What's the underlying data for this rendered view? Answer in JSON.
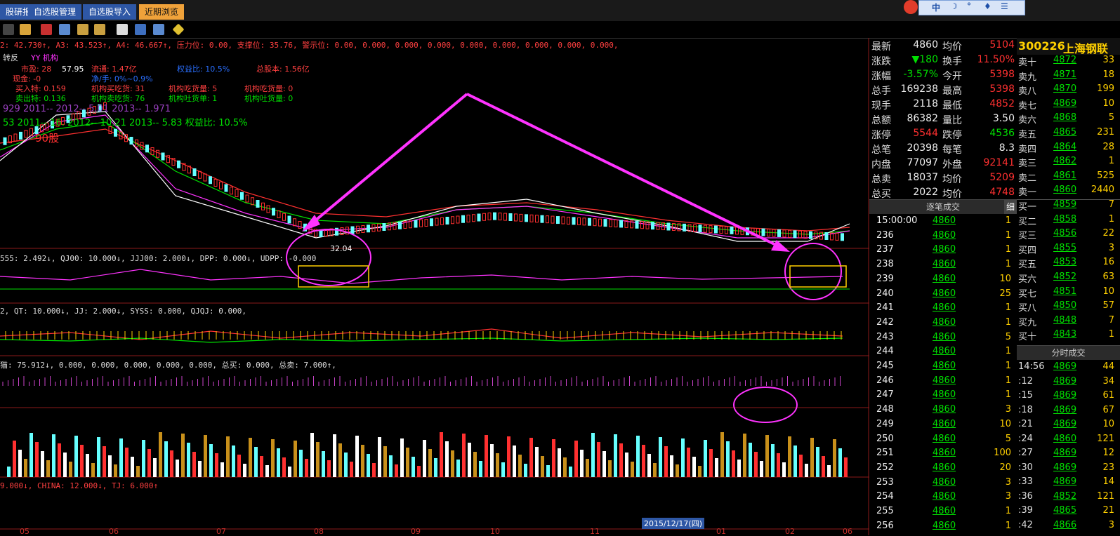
{
  "menu": {
    "items": [
      "股研报",
      "自选股管理",
      "自选股导入",
      "近期浏览"
    ],
    "active_index": 3
  },
  "sys_icons": [
    "中",
    "☽",
    "°",
    "♦",
    "☰"
  ],
  "indicator_line1": "2: 42.730↑, A3: 43.523↑, A4: 46.667↑, 压力位: 0.00, 支撑位: 35.76, 警示位: 0.00, 0.000, 0.000, 0.000, 0.000, 0.000, 0.000, 0.000, 0.000,",
  "chart_info": {
    "label_zhuanfan": "转反",
    "jlmt": "机构",
    "shixiao": "市盈: 28",
    "liutong": "流通: 1.47亿",
    "quanyi": "权益比: 10.5%",
    "zongguben": "总股本: 1.56亿",
    "xianjin": "现金: -0",
    "huanshou": "净/手: 0%~0.9%",
    "mairu": "买入特: 0.159",
    "jg_maichihuo": "机构买吃货: 31",
    "jg_chihuoliang": "机构吃货量: 5",
    "jg_chihuoliang2": "机构吃货量: 0",
    "maichu": "卖出特: 0.136",
    "jg_mai_chihuo": "机构卖吃货: 76",
    "jg_tuhuo": "机构吐货单: 1",
    "jg_tuhuoliang": "机构吐货量: 0",
    "price_top": "57.95",
    "low_price": "32.04",
    "eps_line1": "929  2011--  2012-- 5.01  2013-- 1.971",
    "eps_line2": "53  2011-- 16.  2012-- 10.21  2013-- 5.83  权益比: 10.5%",
    "gu_label": "90股",
    "yy_label": "YY 机构"
  },
  "indicator_line2": "555: 2.492↓, QJ00: 10.000↓, JJJ00: 2.000↓, DPP: 0.000↓, UDPP: -0.000",
  "indicator_line3": "2, QT: 10.000↓, JJ: 2.000↓, SYSS: 0.000, QJQJ: 0.000,",
  "indicator_line4": "猫: 75.912↓, 0.000, 0.000, 0.000, 0.000, 0.000, 总买: 0.000, 总卖: 7.000↑,",
  "indicator_line5": "9.000↓, CHINA: 12.000↓, TJ: 6.000↑",
  "x_labels": [
    "05",
    "06",
    "07",
    "08",
    "09",
    "10",
    "11",
    "12",
    "01",
    "02",
    "06"
  ],
  "date_box": "2015/12/17(四)",
  "quote": {
    "code": "300226",
    "name": "上海钢联",
    "rows": [
      {
        "k1": "最新",
        "v1": "4860",
        "k2": "均价",
        "v2": "5104"
      },
      {
        "k1": "涨跌",
        "v1": "▼180",
        "k2": "换手",
        "v2": "11.50%"
      },
      {
        "k1": "涨幅",
        "v1": "-3.57%",
        "k2": "今开",
        "v2": "5398"
      },
      {
        "k1": "总手",
        "v1": "169238",
        "k2": "最高",
        "v2": "5398"
      },
      {
        "k1": "现手",
        "v1": "2118",
        "k2": "最低",
        "v2": "4852"
      },
      {
        "k1": "总额",
        "v1": "86382",
        "k2": "量比",
        "v2": "3.50"
      },
      {
        "k1": "涨停",
        "v1": "5544",
        "k2": "跌停",
        "v2": "4536"
      },
      {
        "k1": "总笔",
        "v1": "20398",
        "k2": "每笔",
        "v2": "8.3"
      },
      {
        "k1": "内盘",
        "v1": "77097",
        "k2": "外盘",
        "v2": "92141"
      },
      {
        "k1": "总卖",
        "v1": "18037",
        "k2": "均价",
        "v2": "5209"
      },
      {
        "k1": "总买",
        "v1": "2022",
        "k2": "均价",
        "v2": "4748"
      }
    ]
  },
  "orderbook": {
    "sell": [
      {
        "label": "卖十",
        "price": "4872",
        "vol": "33"
      },
      {
        "label": "卖九",
        "price": "4871",
        "vol": "18"
      },
      {
        "label": "卖八",
        "price": "4870",
        "vol": "199"
      },
      {
        "label": "卖七",
        "price": "4869",
        "vol": "10"
      },
      {
        "label": "卖六",
        "price": "4868",
        "vol": "5"
      },
      {
        "label": "卖五",
        "price": "4865",
        "vol": "231"
      },
      {
        "label": "卖四",
        "price": "4864",
        "vol": "28"
      },
      {
        "label": "卖三",
        "price": "4862",
        "vol": "1"
      },
      {
        "label": "卖二",
        "price": "4861",
        "vol": "525"
      },
      {
        "label": "卖一",
        "price": "4860",
        "vol": "2440"
      }
    ],
    "buy": [
      {
        "label": "买一",
        "price": "4859",
        "vol": "7"
      },
      {
        "label": "买二",
        "price": "4858",
        "vol": "1"
      },
      {
        "label": "买三",
        "price": "4856",
        "vol": "22"
      },
      {
        "label": "买四",
        "price": "4855",
        "vol": "3"
      },
      {
        "label": "买五",
        "price": "4853",
        "vol": "16"
      },
      {
        "label": "买六",
        "price": "4852",
        "vol": "63"
      },
      {
        "label": "买七",
        "price": "4851",
        "vol": "10"
      },
      {
        "label": "买八",
        "price": "4850",
        "vol": "57"
      },
      {
        "label": "买九",
        "price": "4848",
        "vol": "7"
      },
      {
        "label": "买十",
        "price": "4843",
        "vol": "1"
      }
    ]
  },
  "ticks_head": "逐笔成交",
  "ticks_tab": "细",
  "ticks": [
    {
      "t": "15:00:00",
      "p": "4860",
      "v": "1"
    },
    {
      "t": "236",
      "p": "4860",
      "v": "1"
    },
    {
      "t": "237",
      "p": "4860",
      "v": "1"
    },
    {
      "t": "238",
      "p": "4860",
      "v": "1"
    },
    {
      "t": "239",
      "p": "4860",
      "v": "10"
    },
    {
      "t": "240",
      "p": "4860",
      "v": "25"
    },
    {
      "t": "241",
      "p": "4860",
      "v": "1"
    },
    {
      "t": "242",
      "p": "4860",
      "v": "1"
    },
    {
      "t": "243",
      "p": "4860",
      "v": "5"
    },
    {
      "t": "244",
      "p": "4860",
      "v": "1"
    },
    {
      "t": "245",
      "p": "4860",
      "v": "1"
    },
    {
      "t": "246",
      "p": "4860",
      "v": "1"
    },
    {
      "t": "247",
      "p": "4860",
      "v": "1"
    },
    {
      "t": "248",
      "p": "4860",
      "v": "3"
    },
    {
      "t": "249",
      "p": "4860",
      "v": "10"
    },
    {
      "t": "250",
      "p": "4860",
      "v": "5"
    },
    {
      "t": "251",
      "p": "4860",
      "v": "100"
    },
    {
      "t": "252",
      "p": "4860",
      "v": "20"
    },
    {
      "t": "253",
      "p": "4860",
      "v": "3"
    },
    {
      "t": "254",
      "p": "4860",
      "v": "3"
    },
    {
      "t": "255",
      "p": "4860",
      "v": "1"
    },
    {
      "t": "256",
      "p": "4860",
      "v": "1"
    }
  ],
  "ticks2_head": "分时成交",
  "ticks2": [
    {
      "t": "14:56",
      "p": "4869",
      "v": "44"
    },
    {
      "t": ":12",
      "p": "4869",
      "v": "34"
    },
    {
      "t": ":15",
      "p": "4869",
      "v": "61"
    },
    {
      "t": ":18",
      "p": "4869",
      "v": "67"
    },
    {
      "t": ":21",
      "p": "4869",
      "v": "10"
    },
    {
      "t": ":24",
      "p": "4860",
      "v": "121"
    },
    {
      "t": ":27",
      "p": "4869",
      "v": "12"
    },
    {
      "t": ":30",
      "p": "4869",
      "v": "23"
    },
    {
      "t": ":33",
      "p": "4869",
      "v": "14"
    },
    {
      "t": ":36",
      "p": "4852",
      "v": "121"
    },
    {
      "t": ":39",
      "p": "4865",
      "v": "21"
    },
    {
      "t": ":42",
      "p": "4866",
      "v": "3"
    }
  ],
  "colors": {
    "up": "#ff3030",
    "down": "#00e000",
    "accent": "#ff33ff",
    "yellow": "#ffd000",
    "cyan": "#66ffff"
  }
}
